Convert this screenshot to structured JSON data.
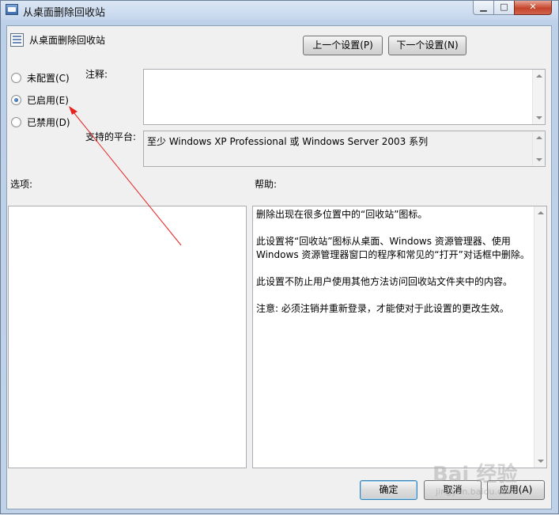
{
  "window": {
    "title": "从桌面删除回收站",
    "min_glyph": "▁",
    "max_glyph": "□",
    "close_glyph": "✕"
  },
  "header": {
    "policy_title": "从桌面删除回收站",
    "prev_setting": "上一个设置(P)",
    "next_setting": "下一个设置(N)"
  },
  "state": {
    "options": [
      {
        "label": "未配置(C)",
        "checked": false
      },
      {
        "label": "已启用(E)",
        "checked": true
      },
      {
        "label": "已禁用(D)",
        "checked": false
      }
    ]
  },
  "comment": {
    "label": "注释:",
    "value": ""
  },
  "platform": {
    "label": "支持的平台:",
    "value": "至少 Windows XP Professional 或 Windows Server 2003 系列"
  },
  "options_section": {
    "label": "选项:"
  },
  "help": {
    "label": "帮助:",
    "paragraphs": [
      "删除出现在很多位置中的“回收站”图标。",
      "此设置将“回收站”图标从桌面、Windows 资源管理器、使用 Windows 资源管理器窗口的程序和常见的“打开”对话框中删除。",
      "此设置不防止用户使用其他方法访问回收站文件夹中的内容。",
      "注意: 必须注销并重新登录，才能使对于此设置的更改生效。"
    ]
  },
  "footer": {
    "ok": "确定",
    "cancel": "取消",
    "apply": "应用(A)"
  },
  "watermark": {
    "brand": "Bai 经验",
    "url": "jingyan.baidu.com"
  },
  "colors": {
    "annotation": "#e8211d",
    "default_button_border": "#3c7fb1"
  }
}
